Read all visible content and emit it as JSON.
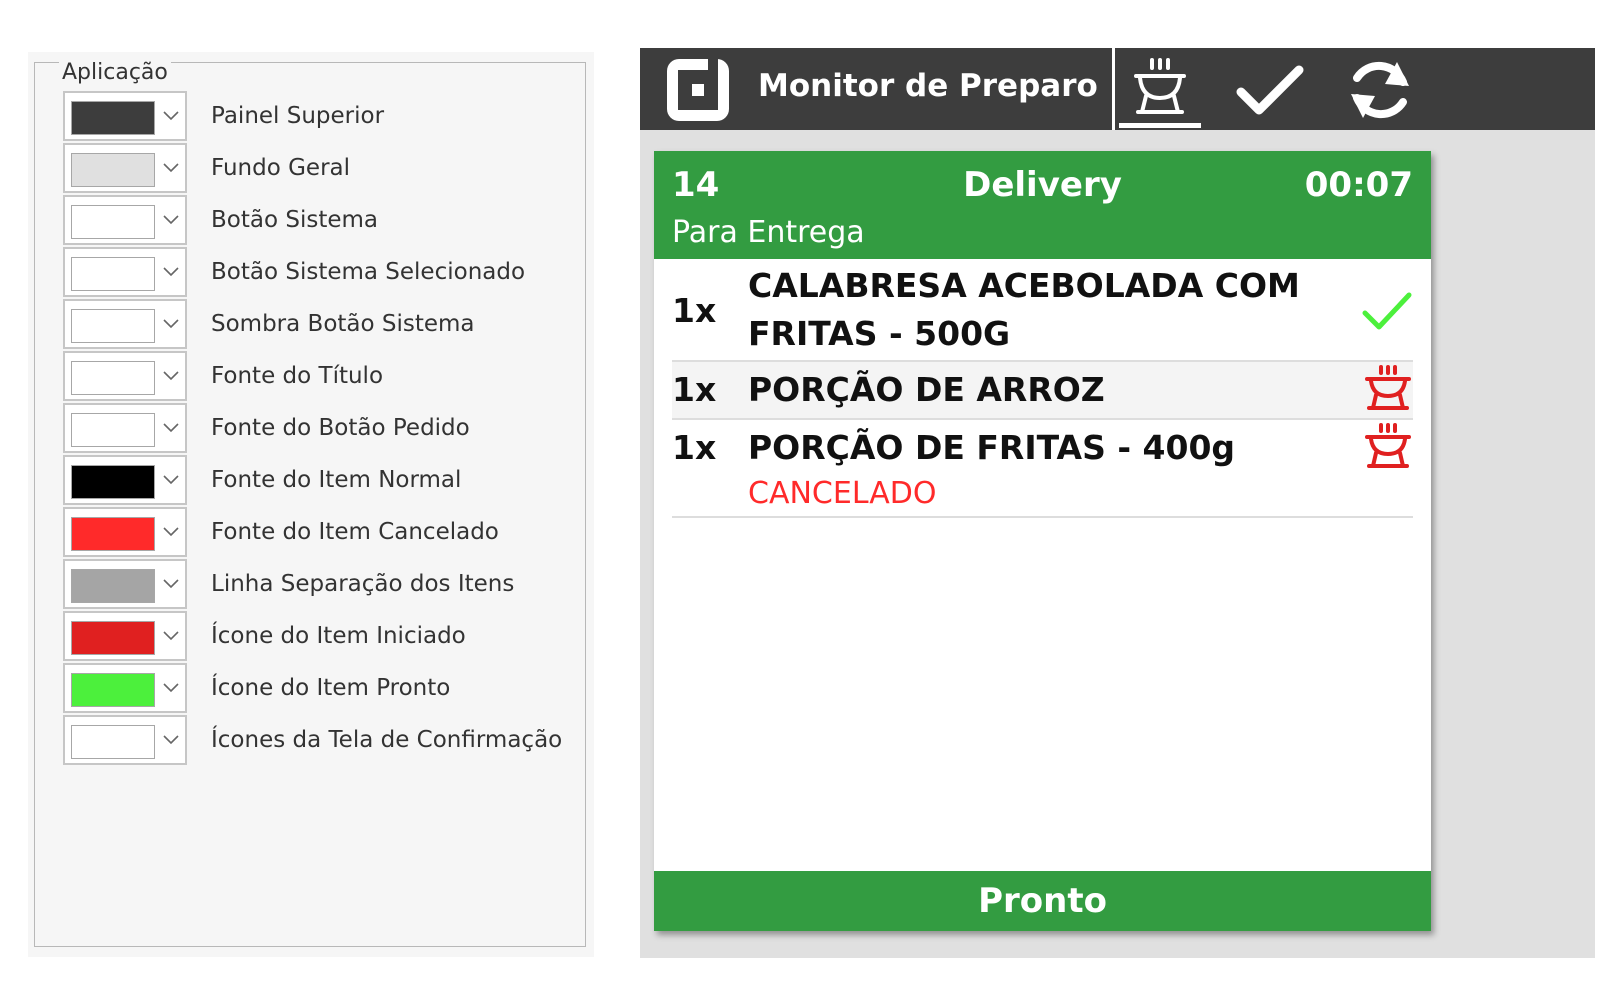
{
  "settings": {
    "group_title": "Aplicação",
    "items": [
      {
        "label": "Painel Superior",
        "color": "#3d3d3d"
      },
      {
        "label": "Fundo Geral",
        "color": "#e0e0e0"
      },
      {
        "label": "Botão Sistema",
        "color": "#ffffff"
      },
      {
        "label": "Botão Sistema Selecionado",
        "color": "#ffffff"
      },
      {
        "label": "Sombra Botão Sistema",
        "color": "#ffffff"
      },
      {
        "label": "Fonte do Título",
        "color": "#ffffff"
      },
      {
        "label": "Fonte do Botão Pedido",
        "color": "#ffffff"
      },
      {
        "label": "Fonte do Item Normal",
        "color": "#000000"
      },
      {
        "label": "Fonte do Item Cancelado",
        "color": "#ff2a2a"
      },
      {
        "label": "Linha Separação dos Itens",
        "color": "#a5a5a5"
      },
      {
        "label": "Ícone do Item Iniciado",
        "color": "#e02020"
      },
      {
        "label": "Ícone do Item Pronto",
        "color": "#4cf03c"
      },
      {
        "label": "Ícones da Tela de Confirmação",
        "color": "#ffffff"
      }
    ]
  },
  "preview": {
    "app_title": "Monitor de Preparo",
    "toolbar_icons": [
      "cooking-pot-icon",
      "check-icon",
      "refresh-icon"
    ],
    "order": {
      "number": "14",
      "type": "Delivery",
      "elapsed": "00:07",
      "mode": "Para Entrega",
      "header_color": "#339c41",
      "items": [
        {
          "qty": "1x",
          "name_line1": "CALABRESA ACEBOLADA COM",
          "name_line2": "FRITAS - 500G",
          "status_icon": "check-icon",
          "icon_color": "#4cf03c"
        },
        {
          "qty": "1x",
          "name_line1": "PORÇÃO DE ARROZ",
          "status_icon": "cooking-pot-icon",
          "icon_color": "#e02020"
        },
        {
          "qty": "1x",
          "name_line1": "PORÇÃO DE FRITAS - 400g",
          "status_text": "CANCELADO",
          "status_icon": "cooking-pot-icon",
          "icon_color": "#e02020"
        }
      ],
      "ready_button_label": "Pronto"
    }
  }
}
